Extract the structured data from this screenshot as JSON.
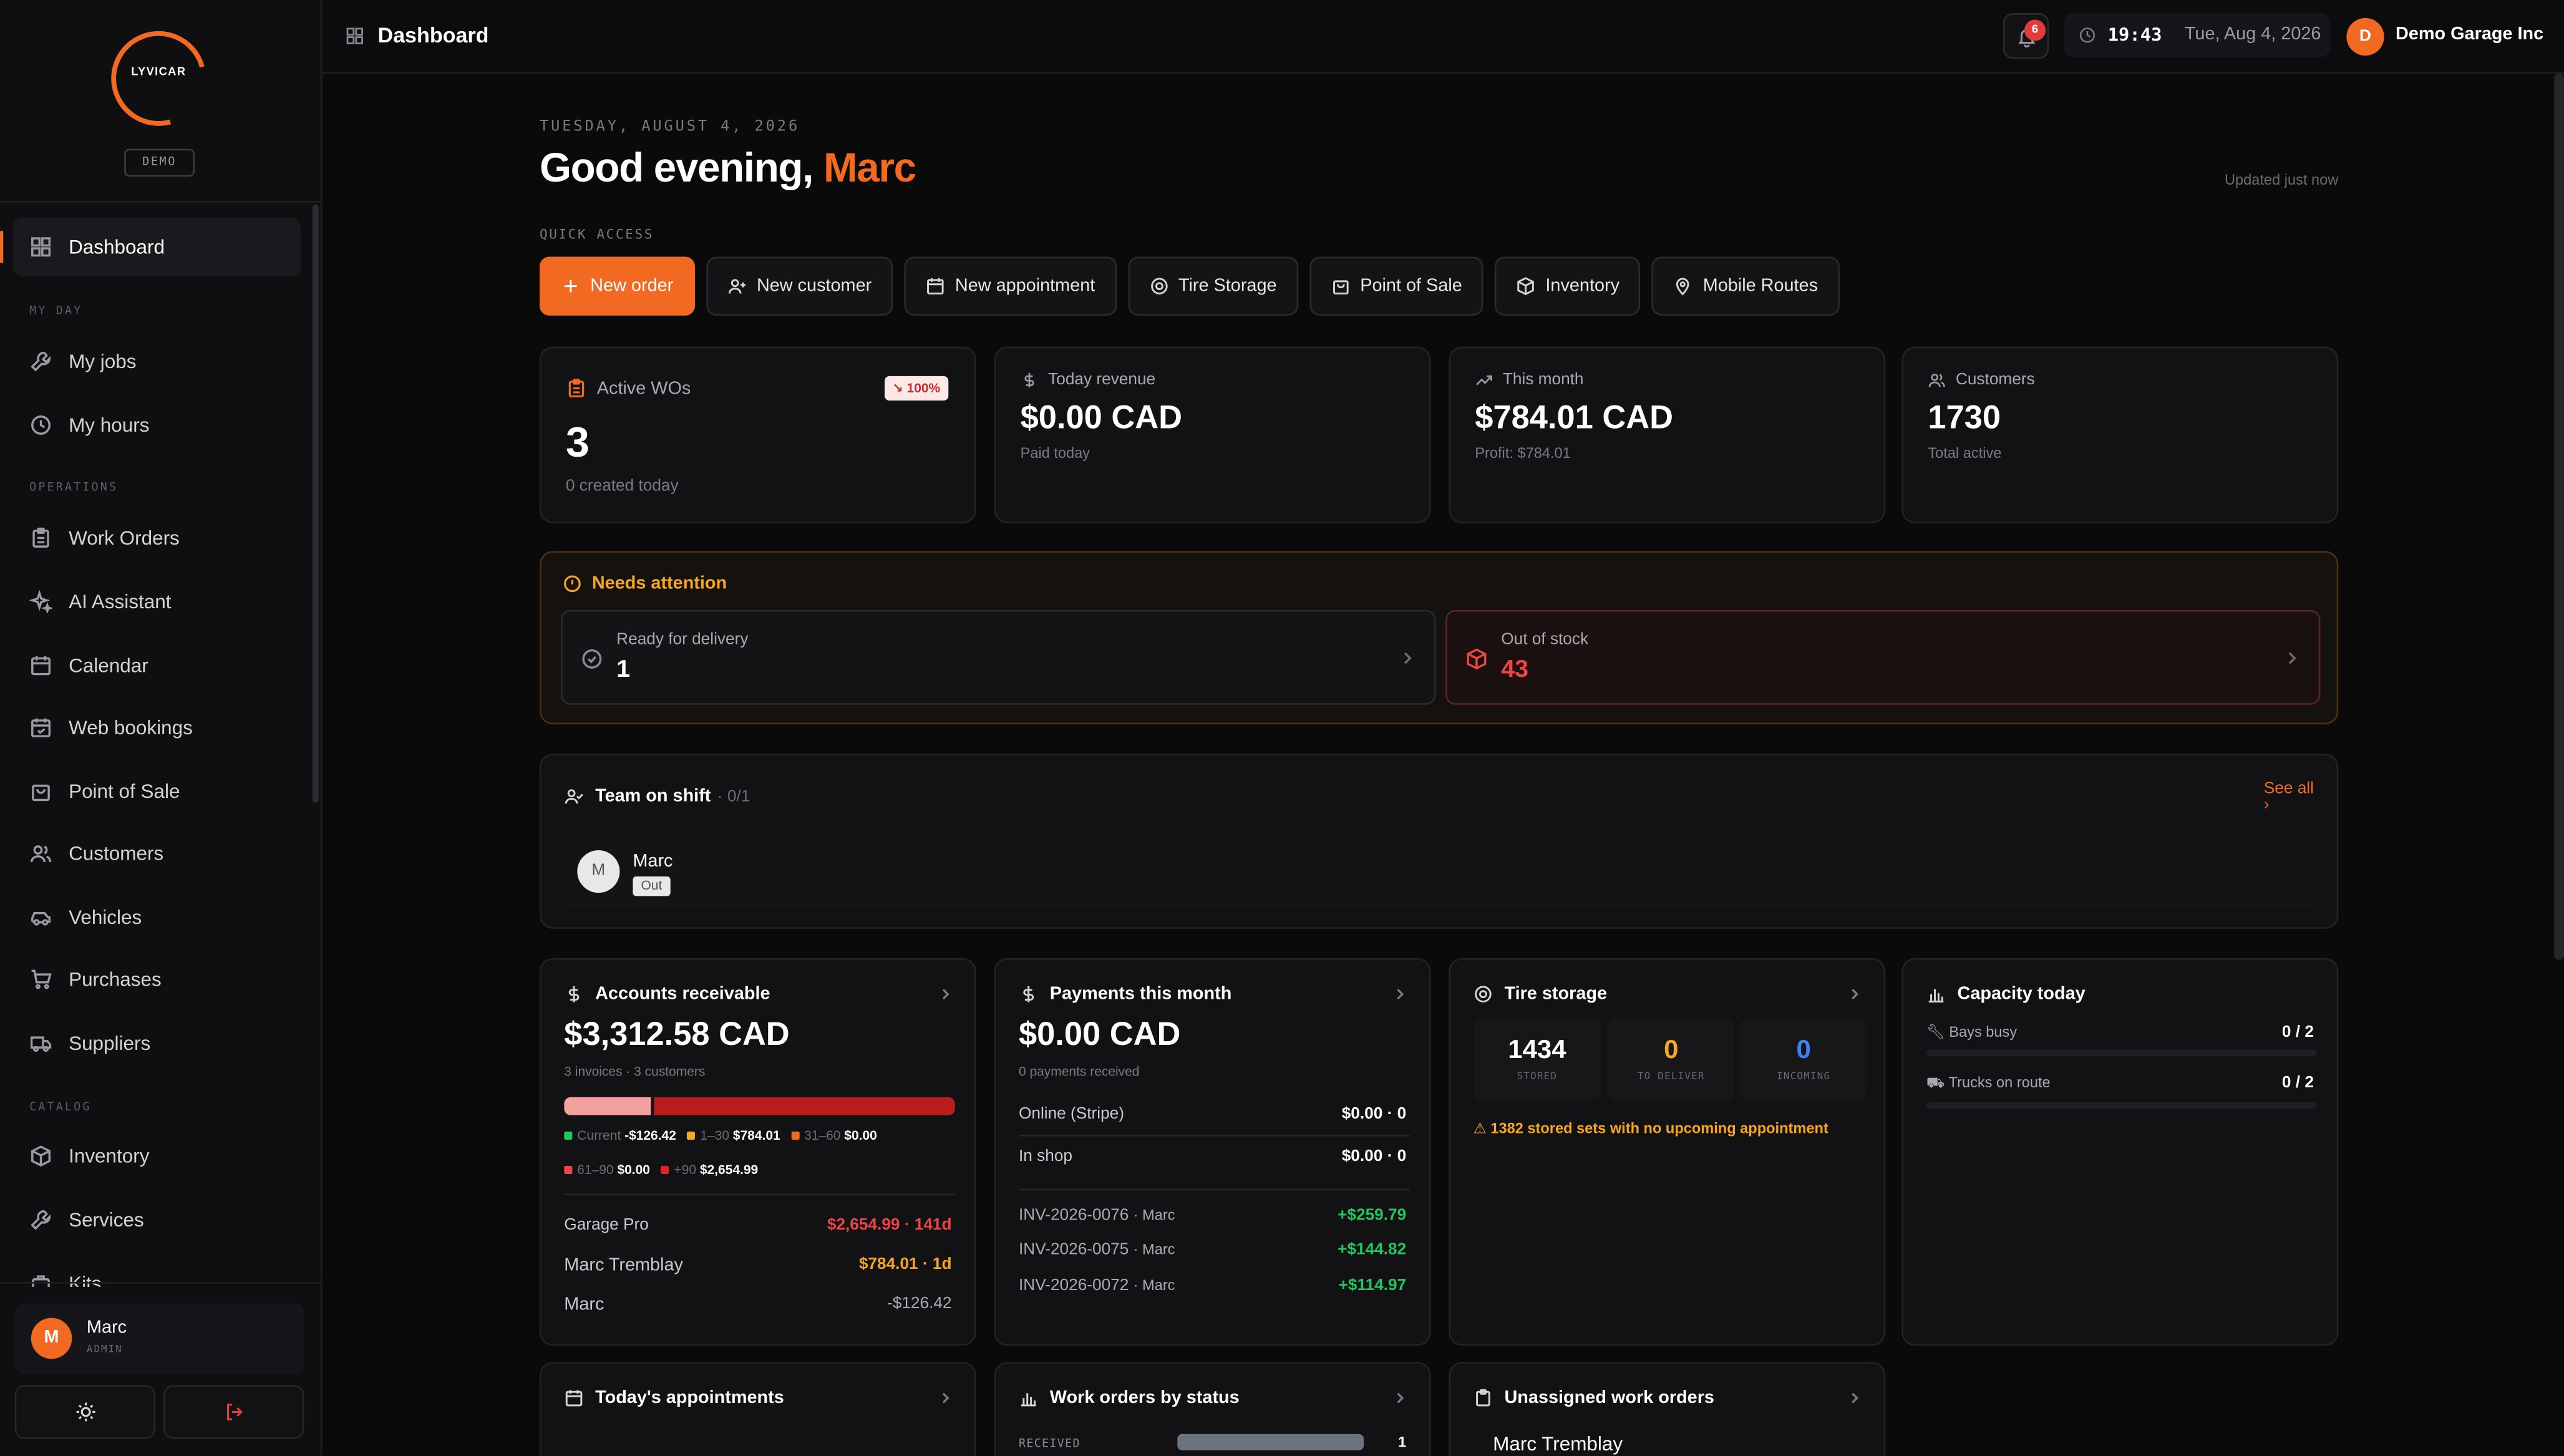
{
  "brand": {
    "logo": "LYVICAR",
    "badge": "DEMO"
  },
  "sidebar": {
    "items": [
      {
        "label": "Dashboard"
      },
      {
        "section": "MY DAY"
      },
      {
        "label": "My jobs"
      },
      {
        "label": "My hours"
      },
      {
        "section": "OPERATIONS"
      },
      {
        "label": "Work Orders"
      },
      {
        "label": "AI Assistant"
      },
      {
        "label": "Calendar"
      },
      {
        "label": "Web bookings"
      },
      {
        "label": "Point of Sale"
      },
      {
        "label": "Customers"
      },
      {
        "label": "Vehicles"
      },
      {
        "label": "Purchases"
      },
      {
        "label": "Suppliers"
      },
      {
        "section": "CATALOG"
      },
      {
        "label": "Inventory"
      },
      {
        "label": "Services"
      },
      {
        "label": "Kits"
      }
    ],
    "user": {
      "initial": "M",
      "name": "Marc",
      "role": "ADMIN"
    }
  },
  "topbar": {
    "title": "Dashboard",
    "notifications": "6",
    "time": "19:43",
    "date": "Tue, Aug 4, 2026",
    "org_initial": "D",
    "org_name": "Demo Garage Inc"
  },
  "header": {
    "date": "TUESDAY, AUGUST 4, 2026",
    "greeting": "Good evening,",
    "name": "Marc",
    "updated": "Updated just now",
    "quick_access_label": "QUICK ACCESS"
  },
  "quick_access": [
    "New order",
    "New customer",
    "New appointment",
    "Tire Storage",
    "Point of Sale",
    "Inventory",
    "Mobile Routes"
  ],
  "kpis": {
    "active_wos": {
      "label": "Active WOs",
      "value": "3",
      "sub": "0 created today",
      "trend": "↘ 100%"
    },
    "today_revenue": {
      "label": "Today revenue",
      "value": "$0.00 CAD",
      "sub": "Paid today"
    },
    "this_month": {
      "label": "This month",
      "value": "$784.01 CAD",
      "sub": "Profit: $784.01"
    },
    "customers": {
      "label": "Customers",
      "value": "1730",
      "sub": "Total active"
    }
  },
  "attention": {
    "title": "Needs attention",
    "ready": {
      "label": "Ready for delivery",
      "value": "1"
    },
    "stock": {
      "label": "Out of stock",
      "value": "43"
    }
  },
  "team": {
    "title": "Team on shift",
    "count": "· 0/1",
    "see_all": "See all",
    "member": {
      "initial": "M",
      "name": "Marc",
      "status": "Out"
    }
  },
  "ar": {
    "title": "Accounts receivable",
    "total": "$3,312.58 CAD",
    "sub": "3 invoices · 3 customers",
    "buckets": [
      {
        "label": "Current",
        "value": "-$126.42",
        "color": "#22c55e"
      },
      {
        "label": "1–30",
        "value": "$784.01",
        "color": "#f5a623"
      },
      {
        "label": "31–60",
        "value": "$0.00",
        "color": "#f26a21"
      },
      {
        "label": "61–90",
        "value": "$0.00",
        "color": "#ef4444"
      },
      {
        "label": "+90",
        "value": "$2,654.99",
        "color": "#dc2626"
      }
    ],
    "bar": {
      "light_fraction": 0.23
    },
    "rows": [
      {
        "name": "Garage Pro",
        "value": "$2,654.99 · 141d",
        "color": "#ef4444"
      },
      {
        "name": "Marc Tremblay",
        "value": "$784.01 · 1d",
        "color": "#f5a623"
      },
      {
        "name": "Marc",
        "value": "-$126.42",
        "color": "#a9a9b2"
      }
    ]
  },
  "payments": {
    "title": "Payments this month",
    "total": "$0.00 CAD",
    "sub": "0 payments received",
    "methods": [
      {
        "name": "Online (Stripe)",
        "value": "$0.00 · 0"
      },
      {
        "name": "In shop",
        "value": "$0.00 · 0"
      }
    ],
    "invoices": [
      {
        "id": "INV-2026-0076",
        "who": "· Marc",
        "value": "+$259.79"
      },
      {
        "id": "INV-2026-0075",
        "who": "· Marc",
        "value": "+$144.82"
      },
      {
        "id": "INV-2026-0072",
        "who": "· Marc",
        "value": "+$114.97"
      }
    ]
  },
  "tires": {
    "title": "Tire storage",
    "stored": "1434",
    "stored_label": "STORED",
    "deliver": "0",
    "deliver_label": "TO DELIVER",
    "incoming": "0",
    "incoming_label": "INCOMING",
    "warning": "⚠ 1382 stored sets with no upcoming appointment"
  },
  "capacity": {
    "title": "Capacity today",
    "bays": {
      "label": "Bays busy",
      "value": "0 / 2"
    },
    "trucks": {
      "label": "Trucks on route",
      "value": "0 / 2"
    }
  },
  "appointments": {
    "title": "Today's appointments"
  },
  "wo_status": {
    "title": "Work orders by status",
    "received_label": "RECEIVED",
    "received_value": "1"
  },
  "unassigned": {
    "title": "Unassigned work orders",
    "first": "Marc Tremblay"
  },
  "colors": {
    "accent": "#f26a21",
    "warning": "#f5a623",
    "danger": "#ef4444",
    "success": "#22c55e",
    "info": "#3b82f6"
  }
}
